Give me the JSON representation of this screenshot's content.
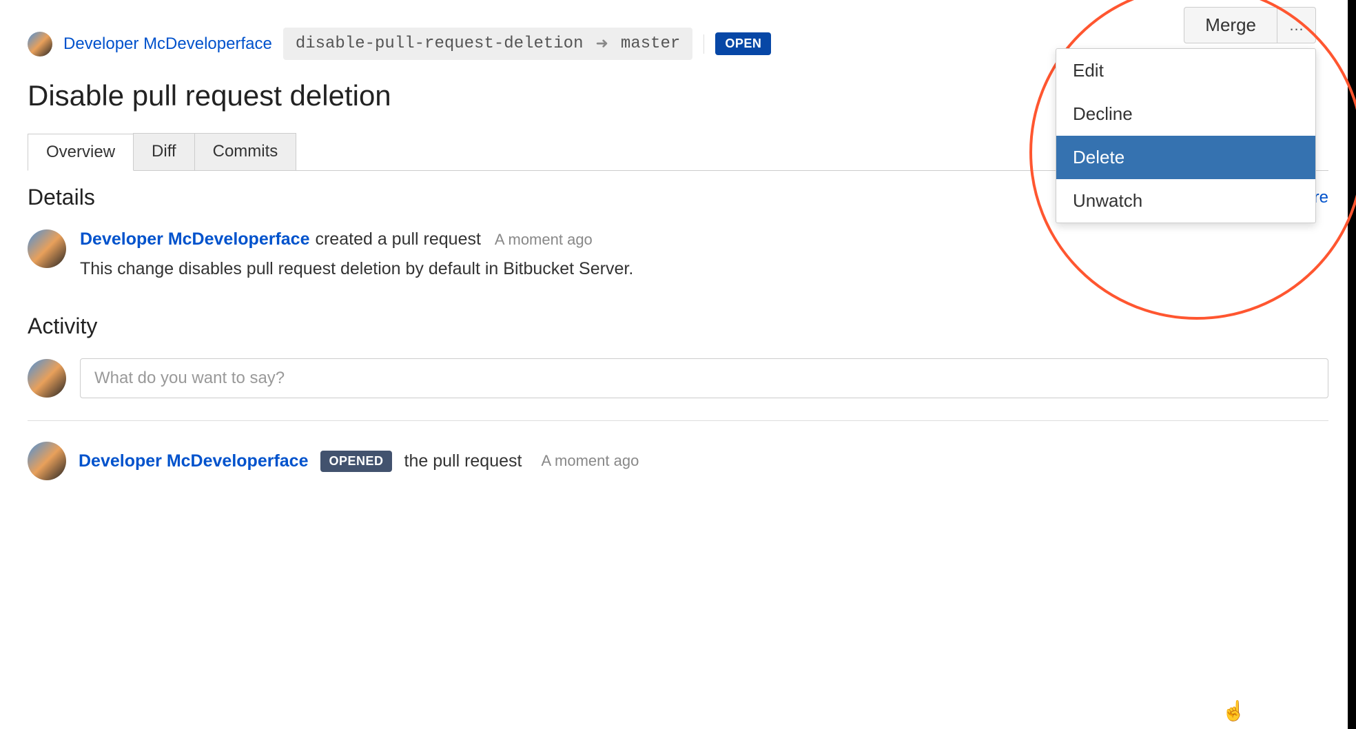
{
  "header": {
    "author": "Developer McDeveloperface",
    "source_branch": "disable-pull-request-deletion",
    "target_branch": "master",
    "status": "OPEN"
  },
  "title": "Disable pull request deletion",
  "tabs": [
    {
      "label": "Overview",
      "active": true
    },
    {
      "label": "Diff",
      "active": false
    },
    {
      "label": "Commits",
      "active": false
    }
  ],
  "details": {
    "heading": "Details",
    "learn_more": "Learn more",
    "author": "Developer McDeveloperface",
    "action": "created a pull request",
    "time": "A moment ago",
    "description": "This change disables pull request deletion by default in Bitbucket Server."
  },
  "activity": {
    "heading": "Activity",
    "placeholder": "What do you want to say?",
    "entry": {
      "author": "Developer McDeveloperface",
      "badge": "OPENED",
      "text": "the pull request",
      "time": "A moment ago"
    }
  },
  "actions": {
    "merge": "Merge",
    "menu": [
      {
        "label": "Edit",
        "highlighted": false
      },
      {
        "label": "Decline",
        "highlighted": false
      },
      {
        "label": "Delete",
        "highlighted": true
      },
      {
        "label": "Unwatch",
        "highlighted": false
      }
    ]
  }
}
